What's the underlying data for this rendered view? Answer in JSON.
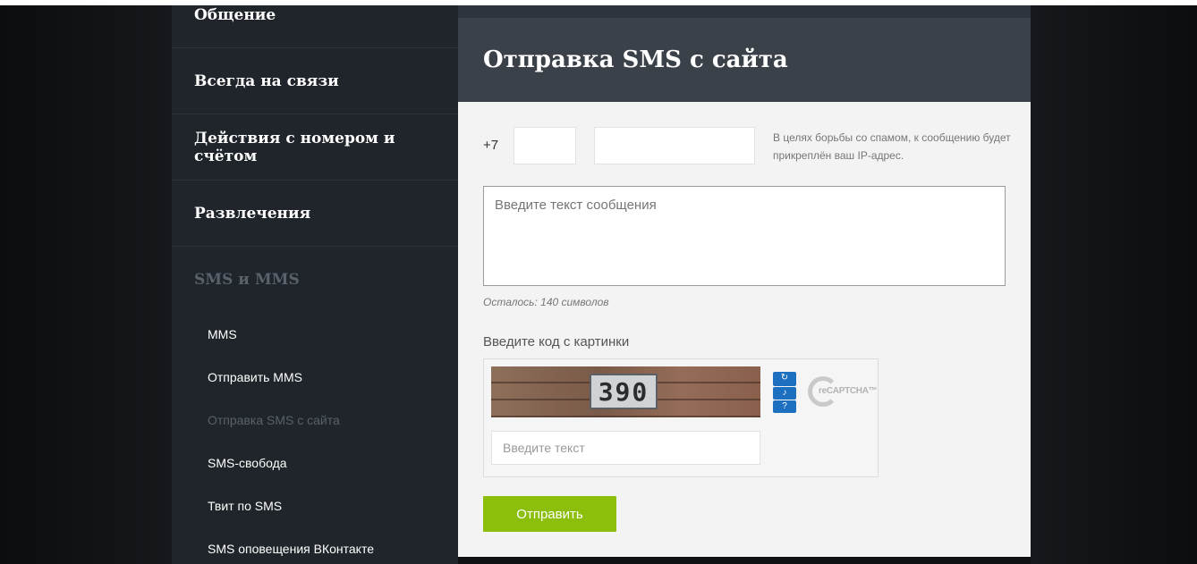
{
  "sidebar": {
    "sections": [
      {
        "label": "Общение"
      },
      {
        "label": "Всегда на связи"
      },
      {
        "label": "Действия с номером и счётом"
      },
      {
        "label": "Развлечения"
      },
      {
        "label": "SMS и MMS"
      }
    ],
    "sub_items": [
      {
        "label": "MMS"
      },
      {
        "label": "Отправить MMS"
      },
      {
        "label": "Отправка SMS с сайта",
        "active": true
      },
      {
        "label": "SMS-свобода"
      },
      {
        "label": "Твит по SMS"
      },
      {
        "label": "SMS оповещения ВКонтакте"
      }
    ]
  },
  "main": {
    "title": "Отправка SMS с сайта",
    "phone_prefix": "+7",
    "spam_note": "В целях борьбы со спамом, к сообщению будет прикреплён ваш IP-адрес.",
    "message_placeholder": "Введите текст сообщения",
    "remaining": "Осталось: 140 символов",
    "captcha_label": "Введите код с картинки",
    "captcha_code": "390",
    "captcha_input_placeholder": "Введите текст",
    "recaptcha_logo_text": "reCAPTCHA™",
    "send_label": "Отправить"
  },
  "icons": {
    "refresh": "refresh-icon",
    "audio": "audio-icon",
    "help": "help-icon"
  },
  "colors": {
    "accent_green": "#8cbf0c",
    "sidebar_bg": "#20252b",
    "header_bg": "#3b4148",
    "captcha_blue": "#1d6fbf"
  }
}
